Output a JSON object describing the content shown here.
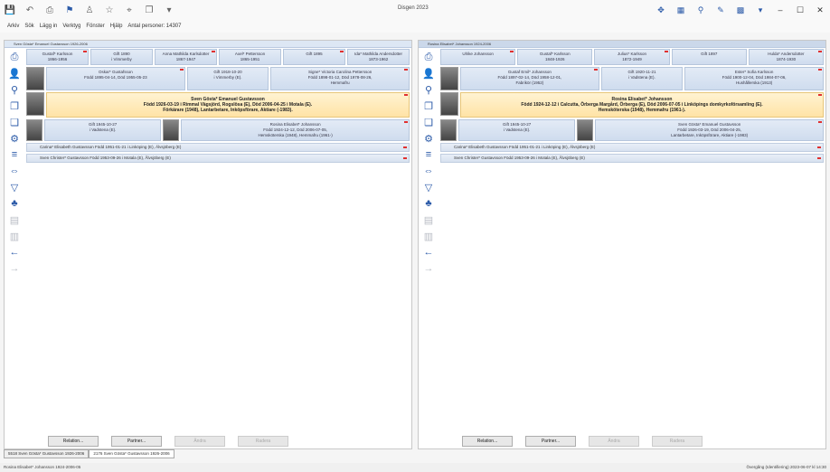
{
  "window": {
    "title": "Disgen 2023",
    "controls": [
      "–",
      "☐",
      "✕"
    ]
  },
  "toolbar_left_icons": [
    "save-icon",
    "undo-icon",
    "print-icon",
    "flag-icon",
    "person-icon",
    "star-icon",
    "pin-icon",
    "copy-icon",
    "dropdown-icon"
  ],
  "toolbar_right_icons": [
    "settings-icon",
    "calendar-icon",
    "search-icon",
    "pencil-icon",
    "grid-icon",
    "dropdown-icon"
  ],
  "menu": {
    "items": [
      "Arkiv",
      "Sök",
      "Lägg in",
      "Verktyg",
      "Fönster",
      "Hjälp"
    ],
    "person_count": "Antal personer: 14307"
  },
  "left_panel": {
    "header": "Sven Gösta* Emanuel Gustavsson 1926-2006",
    "grandparents": [
      {
        "name": "Gustaf* Karlsson",
        "years": "1866-1956"
      },
      {
        "name": "Gift 1890",
        "years": "i Vimmerby"
      },
      {
        "name": "Anna Mathilda Karlsdotter",
        "years": "1867-1947"
      },
      {
        "name": "Axel* Pettersson",
        "years": "1865-1951"
      },
      {
        "name": "Gift 1895",
        "years": ""
      },
      {
        "name": "Ida* Mathilda Andersdotter",
        "years": "1873-1962"
      }
    ],
    "parents": [
      {
        "lines": [
          "Oskar* Gustafsson",
          "Född 1895-04-14, Död 1955-05-23"
        ]
      },
      {
        "lines": [
          "Gift 1918-10-20",
          "i Vimmerby (E)."
        ]
      },
      {
        "lines": [
          "Signe* Victoria Carolina Pettersson",
          "Född 1898-01-12, Död 1978-08-26,",
          "Hemmafru"
        ]
      }
    ],
    "main": {
      "name": "Sven Gösta* Emanuel Gustavsson",
      "line2": "Född 1926-03-19 i Rimmal Vägsjörd, Rogslösa (E), Död 2006-04-25 i Motala (E).",
      "line3": "Förkärare (1948), Lantarbetare, Inköpsförare, Aktiare (-1983)."
    },
    "spouse_row": [
      {
        "lines": [
          "Gift 1945-10-27",
          "i Vadstena (E)."
        ]
      },
      {
        "lines": [
          "Rosina Elisabet* Johansson",
          "Född 1924-12-12, Död 2006-07-05,",
          "Hemsköterska (1948), Hemmafru (1961-)"
        ]
      }
    ],
    "children": [
      "Carina* Elisabeth Gustavsson Född 1951-01-21 i Linköping (E), Älvsjöberg (E)",
      "Sven Christer* Gustavsson Född 1953-09-26 i Motala (E), Ålvsjöberg (E)"
    ],
    "buttons": [
      "Relation...",
      "Partner...",
      "Ändra",
      "Radera"
    ]
  },
  "right_panel": {
    "header": "Rosina Elisabet* Johansson 1924-2006",
    "grandparents": [
      {
        "name": "Ulrike Johansson",
        "years": ""
      },
      {
        "name": "Gustaf* Karlsson",
        "years": "1848-1926"
      },
      {
        "name": "Julius* Karlsson",
        "years": "1872-1949"
      },
      {
        "name": "Gift 1897",
        "years": ""
      },
      {
        "name": "Hulda* Andersdotter",
        "years": "1874-1930"
      }
    ],
    "parents": [
      {
        "lines": [
          "Gustaf Emil* Johansson",
          "Född 1897-02-14, Död 1958-12-01,",
          "Fabrikör (1952)"
        ]
      },
      {
        "lines": [
          "Gift 1920-11-21",
          "i Vadstena (E)."
        ]
      },
      {
        "lines": [
          "Ester* Sofia Karlsson",
          "Född 1900-12-04, Död 1984-07-06,",
          "Hushållerska (1913)"
        ]
      }
    ],
    "main": {
      "name": "Rosina Elisabet* Johansson",
      "line2": "Född 1924-12-12 i Calcutta, Örberga Margård, Örberga (E), Död 2006-07-05 i Linköpings domkyrkoförsamling (E).",
      "line3": "Hemsköterska (1948), Hemmafru (1961-)."
    },
    "spouse_row": [
      {
        "lines": [
          "Gift 1945-10-27",
          "i Vadstena (E)."
        ]
      },
      {
        "lines": [
          "Sven Gösta* Emanuel Gustavsson",
          "Född 1926-03-19, Död 2006-04-25,",
          "Lantarbetare, Inköpsförare, Aktiare (-1983)"
        ]
      }
    ],
    "children": [
      "Carina* Elisabeth Gustavsson Född 1951-01-21 i Linköping (E), Älvsjöberg (E)",
      "Sven Christer* Gustavsson Född 1953-09-26 i Motala (E), Ålvsjöberg (E)"
    ],
    "buttons": [
      "Relation...",
      "Partner...",
      "Ändra",
      "Radera"
    ]
  },
  "sidebar_icons": [
    {
      "name": "print-icon",
      "glyph": "⎙"
    },
    {
      "name": "person-icon",
      "glyph": "👤"
    },
    {
      "name": "search-icon",
      "glyph": "⚲"
    },
    {
      "name": "copy-icon",
      "glyph": "❐"
    },
    {
      "name": "duplicate-icon",
      "glyph": "❏"
    },
    {
      "name": "settings-icon",
      "glyph": "⚙"
    },
    {
      "name": "list-icon",
      "glyph": "≡"
    },
    {
      "name": "swap-icon",
      "glyph": "⇔"
    },
    {
      "name": "filter-icon",
      "glyph": "▽"
    },
    {
      "name": "tree-icon",
      "glyph": "♣"
    },
    {
      "name": "note-icon",
      "glyph": "▤"
    },
    {
      "name": "archive-icon",
      "glyph": "▥"
    },
    {
      "name": "back-arrow-icon",
      "glyph": "←"
    },
    {
      "name": "forward-arrow-icon",
      "glyph": "→"
    }
  ],
  "tabs": [
    "5518 Sven Gösta* Gustavsson 1926-2006",
    "2176 Sven Gösta* Gustavsson 1926-2006"
  ],
  "status": {
    "left": "Rosina Elisabet* Johansson 1924-2006-05",
    "right": "Övergång (Identifiering) 2023-06-07 kl 14:30"
  },
  "colors": {
    "accent": "#2b5aa8",
    "main_person_bg": "#ffe8b0",
    "box_bg": "#d8e3f2",
    "flag": "#e03030"
  }
}
